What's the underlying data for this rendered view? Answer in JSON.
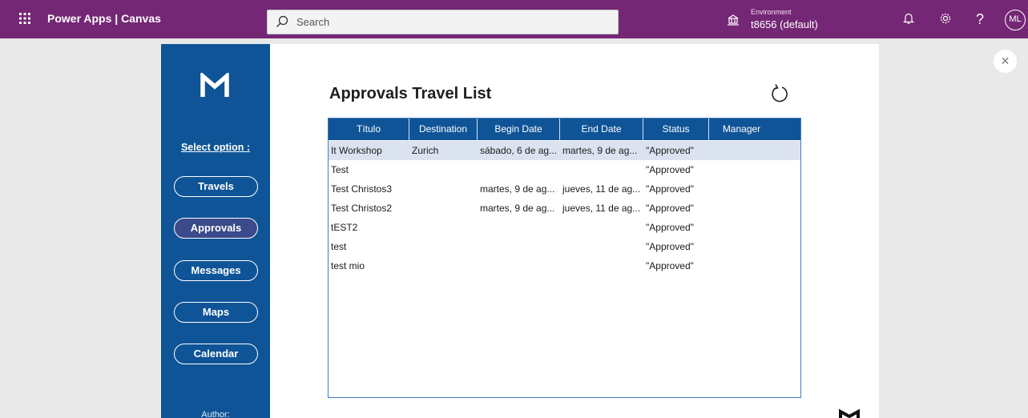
{
  "topbar": {
    "app_name": "Power Apps  |  Canvas",
    "search_placeholder": "Search",
    "environment_label": "Environment",
    "environment_value": "t8656 (default)",
    "avatar_initials": "ML"
  },
  "sidebar": {
    "select_label": "Select option :",
    "buttons": [
      {
        "label": "Travels",
        "active": false
      },
      {
        "label": "Approvals",
        "active": true
      },
      {
        "label": "Messages",
        "active": false
      },
      {
        "label": "Maps",
        "active": false
      },
      {
        "label": "Calendar",
        "active": false
      }
    ],
    "author_label": "Author:"
  },
  "main": {
    "title": "Approvals Travel List",
    "columns": [
      "Título",
      "Destination",
      "Begin Date",
      "End Date",
      "Status",
      "Manager"
    ],
    "rows": [
      {
        "titulo": "It Workshop",
        "destination": "Zurich",
        "begin": "sábado, 6 de ag...",
        "end": "martes, 9 de ag...",
        "status": "\"Approved\"",
        "manager": "",
        "selected": true
      },
      {
        "titulo": "Test",
        "destination": "",
        "begin": "",
        "end": "",
        "status": "\"Approved\"",
        "manager": "",
        "selected": false
      },
      {
        "titulo": "Test Christos3",
        "destination": "",
        "begin": "martes, 9 de ag...",
        "end": "jueves, 11 de ag...",
        "status": "\"Approved\"",
        "manager": "",
        "selected": false
      },
      {
        "titulo": "Test Christos2",
        "destination": "",
        "begin": "martes, 9 de ag...",
        "end": "jueves, 11 de ag...",
        "status": "\"Approved\"",
        "manager": "",
        "selected": false
      },
      {
        "titulo": "tEST2",
        "destination": "",
        "begin": "",
        "end": "",
        "status": "\"Approved\"",
        "manager": "",
        "selected": false
      },
      {
        "titulo": "test",
        "destination": "",
        "begin": "",
        "end": "",
        "status": "\"Approved\"",
        "manager": "",
        "selected": false
      },
      {
        "titulo": "test mio",
        "destination": "",
        "begin": "",
        "end": "",
        "status": "\"Approved\"",
        "manager": "",
        "selected": false
      }
    ]
  },
  "icons": {
    "waffle": "waffle-icon",
    "search": "search-icon",
    "environment": "environment-icon",
    "notifications": "bell-icon",
    "settings": "gear-icon",
    "help": "help-icon",
    "close": "close-icon",
    "refresh": "refresh-icon"
  },
  "colors": {
    "topbar": "#742774",
    "sidebar": "#0f5497",
    "header": "#0f5497",
    "selected_row": "#dbe3f0",
    "active_button": "#3b4a8a"
  }
}
